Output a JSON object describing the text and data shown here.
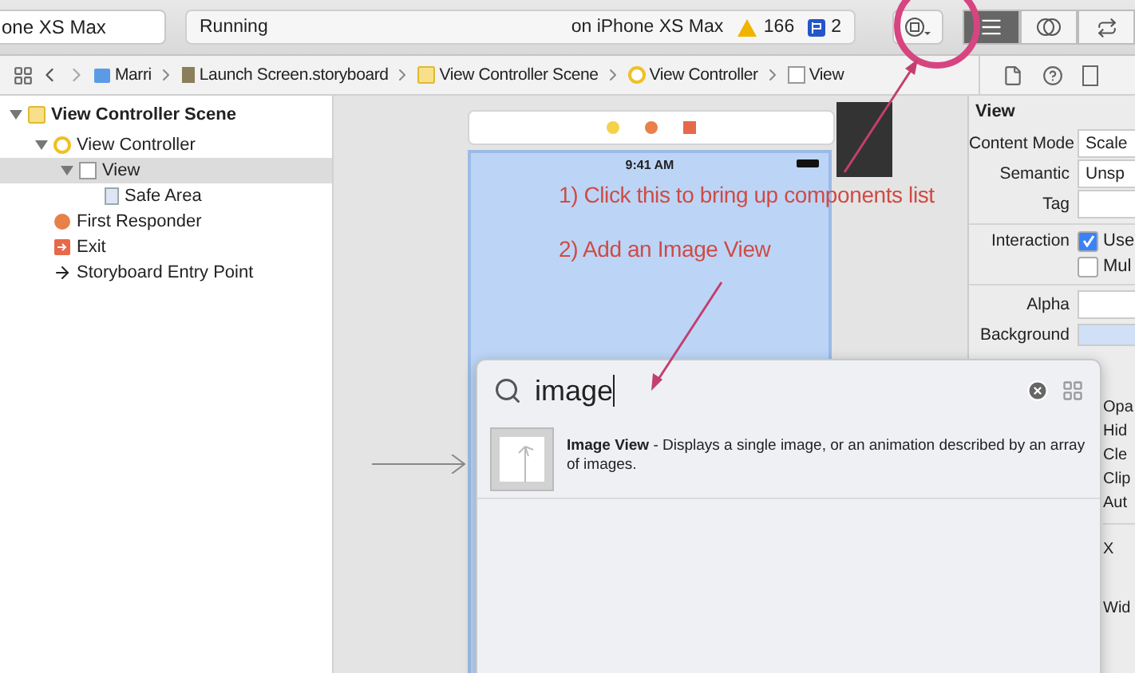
{
  "toolbar": {
    "scheme": "one XS Max",
    "activity": {
      "status": "Running",
      "destination": "on iPhone XS Max",
      "warnings": "166",
      "issues": "2"
    },
    "editor_modes": [
      {
        "kind": "standard",
        "selected": true
      },
      {
        "kind": "assistant",
        "selected": false
      },
      {
        "kind": "version",
        "selected": false
      }
    ]
  },
  "jump_bar": {
    "items": [
      {
        "kind": "folder",
        "label": "Marri"
      },
      {
        "kind": "storyboard",
        "label": "Launch Screen.storyboard"
      },
      {
        "kind": "scene",
        "label": "View Controller Scene"
      },
      {
        "kind": "controller",
        "label": "View Controller"
      },
      {
        "kind": "view",
        "label": "View"
      }
    ]
  },
  "outline": {
    "items": [
      {
        "kind": "scene",
        "label": "View Controller Scene",
        "expanded": true,
        "selected": false,
        "children": [
          {
            "kind": "controller",
            "label": "View Controller",
            "expanded": true,
            "selected": false,
            "children": [
              {
                "kind": "view",
                "label": "View",
                "expanded": true,
                "selected": true,
                "children": [
                  {
                    "kind": "safe_area",
                    "label": "Safe Area",
                    "selected": false
                  }
                ]
              }
            ]
          },
          {
            "kind": "responder",
            "label": "First Responder",
            "selected": false
          },
          {
            "kind": "exit",
            "label": "Exit",
            "selected": false
          },
          {
            "kind": "entry",
            "label": "Storyboard Entry Point",
            "selected": false
          }
        ]
      }
    ]
  },
  "canvas": {
    "status_time": "9:41 AM"
  },
  "annotations": [
    {
      "kind": "step",
      "text": "1) Click this to bring up components list"
    },
    {
      "kind": "step",
      "text": "2) Add an Image View"
    }
  ],
  "inspector": {
    "title": "View",
    "rows": [
      {
        "kind": "popup",
        "label": "Content Mode",
        "value": "Scale"
      },
      {
        "kind": "popup",
        "label": "Semantic",
        "value": "Unsp"
      },
      {
        "kind": "field",
        "label": "Tag"
      },
      {
        "kind": "checkbox",
        "label": "Interaction",
        "value": "Use",
        "checked": true
      },
      {
        "kind": "checkbox",
        "value": "Mul",
        "checked": false
      },
      {
        "kind": "field",
        "label": "Alpha"
      },
      {
        "kind": "color",
        "label": "Background"
      }
    ],
    "peek": [
      "Opa",
      "Hid",
      "Cle",
      "Clip",
      "Aut"
    ],
    "lower": [
      "X",
      "Wid"
    ]
  },
  "library": {
    "search": {
      "value": "image"
    },
    "results": [
      {
        "text": "**Image View** - Displays a single image, or an animation described by an array of images."
      }
    ]
  }
}
